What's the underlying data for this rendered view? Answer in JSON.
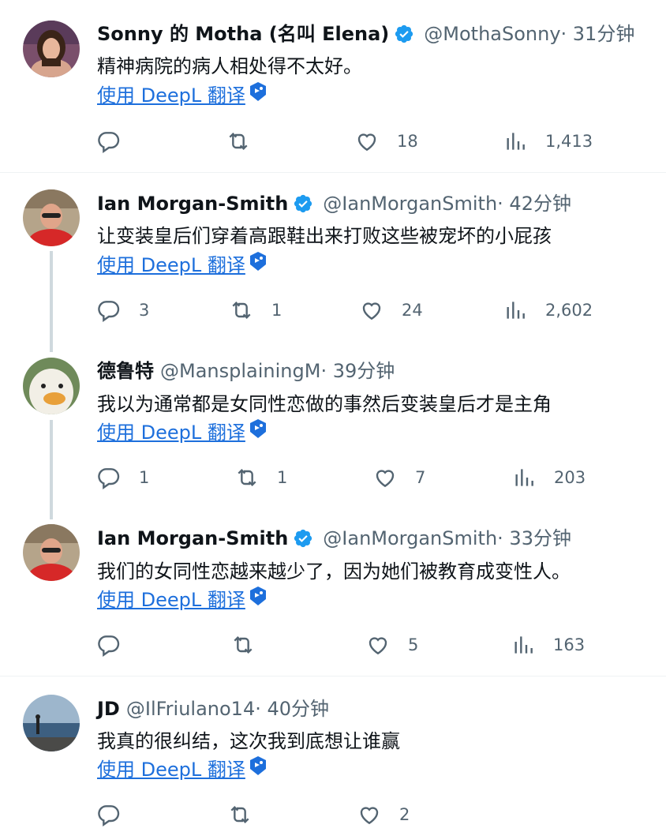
{
  "translate_label": "使用 DeepL 翻译",
  "colors": {
    "link": "#1d6fdc",
    "verified": "#1d9bf0",
    "muted": "#536471",
    "thread_line": "#cfd9de"
  },
  "tweets": [
    {
      "name": "Sonny 的 Motha (名叫 Elena)",
      "verified": true,
      "handle": "@MothaSonny",
      "time": "· 31分钟",
      "text": "精神病院的病人相处得不太好。",
      "replies": "",
      "retweets": "",
      "likes": "18",
      "views": "1,413"
    },
    {
      "name": "Ian Morgan-Smith",
      "verified": true,
      "handle": "@IanMorganSmith",
      "time": "· 42分钟",
      "text": "让变装皇后们穿着高跟鞋出来打败这些被宠坏的小屁孩",
      "replies": "3",
      "retweets": "1",
      "likes": "24",
      "views": "2,602"
    },
    {
      "name": "德鲁特",
      "verified": false,
      "handle": "@MansplainingM",
      "time": "· 39分钟",
      "text": "我以为通常都是女同性恋做的事然后变装皇后才是主角",
      "replies": "1",
      "retweets": "1",
      "likes": "7",
      "views": "203"
    },
    {
      "name": "Ian Morgan-Smith",
      "verified": true,
      "handle": "@IanMorganSmith",
      "time": "· 33分钟",
      "text": "我们的女同性恋越来越少了，因为她们被教育成变性人。",
      "replies": "",
      "retweets": "",
      "likes": "5",
      "views": "163"
    },
    {
      "name": "JD",
      "verified": false,
      "handle": "@IlFriulano14",
      "time": "· 40分钟",
      "text": "我真的很纠结，这次我到底想让谁赢",
      "replies": "",
      "retweets": "",
      "likes": "2",
      "views": ""
    }
  ]
}
